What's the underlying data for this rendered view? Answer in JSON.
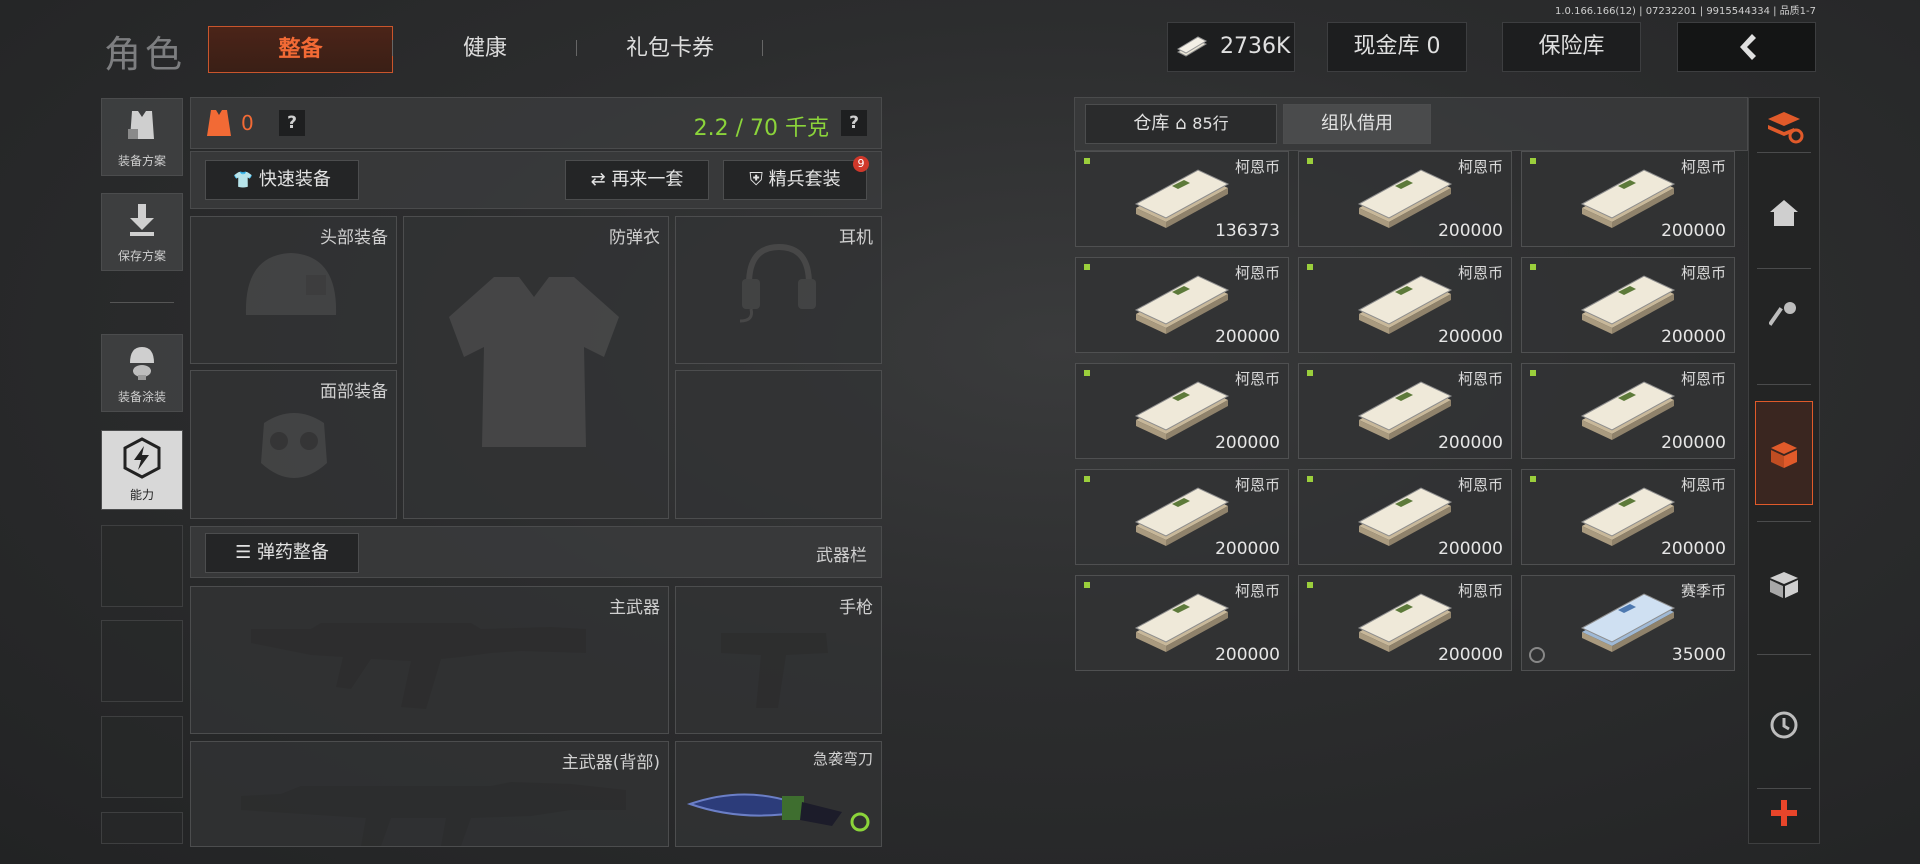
{
  "version": "1.0.166.166(12) | 07232201 | 9915544334 | 品质1-7",
  "header": {
    "title": "角色",
    "tabs": [
      {
        "label": "整备",
        "active": true
      },
      {
        "label": "健康",
        "active": false
      },
      {
        "label": "礼包卡券",
        "active": false
      }
    ],
    "currency": "2736K",
    "cash_vault": "现金库 0",
    "safe": "保险库"
  },
  "sidebar": {
    "items": [
      {
        "label": "装备方案",
        "icon": "vest-plan-icon"
      },
      {
        "label": "保存方案",
        "icon": "download-icon"
      },
      {
        "label": "装备涂装",
        "icon": "helmet-skin-icon"
      },
      {
        "label": "能力",
        "icon": "ability-icon",
        "active": true
      }
    ]
  },
  "loadout": {
    "armor_count": "0",
    "weight": "2.2 / 70 千克",
    "quick_equip": "快速装备",
    "redo": "再来一套",
    "elite_set": "精兵套装",
    "elite_badge": "9",
    "slots": {
      "head": "头部装备",
      "armor": "防弹衣",
      "headset": "耳机",
      "face": "面部装备",
      "ammo": "弹药整备",
      "weapon_bar": "武器栏",
      "primary": "主武器",
      "pistol": "手枪",
      "primary_back": "主武器(背部)",
      "knife": "急袭弯刀"
    }
  },
  "storage": {
    "tabs": [
      {
        "label": "仓库",
        "rows": "85行"
      },
      {
        "label": "组队借用"
      }
    ],
    "items": [
      {
        "name": "柯恩币",
        "amount": "136373",
        "type": "cash"
      },
      {
        "name": "柯恩币",
        "amount": "200000",
        "type": "cash"
      },
      {
        "name": "柯恩币",
        "amount": "200000",
        "type": "cash"
      },
      {
        "name": "柯恩币",
        "amount": "200000",
        "type": "cash"
      },
      {
        "name": "柯恩币",
        "amount": "200000",
        "type": "cash"
      },
      {
        "name": "柯恩币",
        "amount": "200000",
        "type": "cash"
      },
      {
        "name": "柯恩币",
        "amount": "200000",
        "type": "cash"
      },
      {
        "name": "柯恩币",
        "amount": "200000",
        "type": "cash"
      },
      {
        "name": "柯恩币",
        "amount": "200000",
        "type": "cash"
      },
      {
        "name": "柯恩币",
        "amount": "200000",
        "type": "cash"
      },
      {
        "name": "柯恩币",
        "amount": "200000",
        "type": "cash"
      },
      {
        "name": "柯恩币",
        "amount": "200000",
        "type": "cash"
      },
      {
        "name": "柯恩币",
        "amount": "200000",
        "type": "cash"
      },
      {
        "name": "柯恩币",
        "amount": "200000",
        "type": "cash"
      },
      {
        "name": "赛季币",
        "amount": "35000",
        "type": "season"
      }
    ]
  },
  "right_tools": [
    "stack-refresh-icon",
    "home-icon",
    "key-icon",
    "box-download-icon",
    "crate-icon",
    "clock-icon",
    "plus-icon"
  ],
  "colors": {
    "accent": "#f26a35",
    "weight_green": "#8bd43a",
    "item_dot": "#9bcf3c"
  }
}
